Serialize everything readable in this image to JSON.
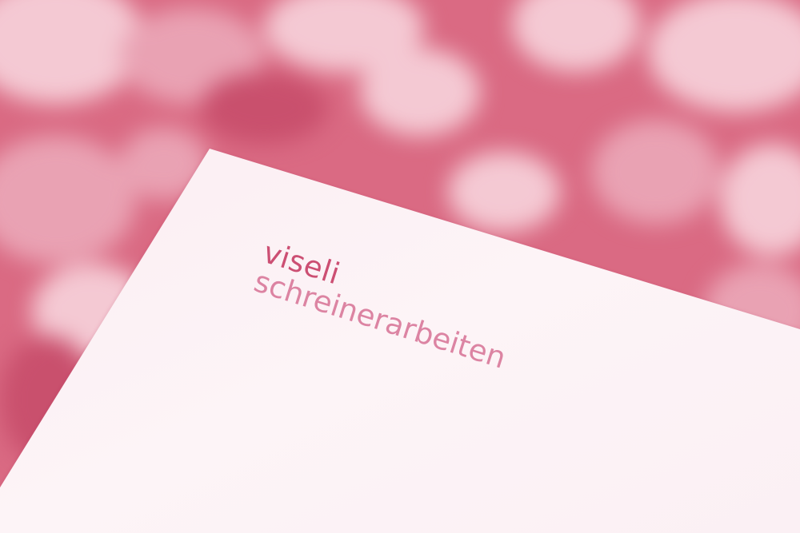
{
  "logo": {
    "brand": "viseli",
    "tagline": "schreinerarbeiten"
  },
  "colors": {
    "background": "#da6a83",
    "paper": "#fdf3f6",
    "brand_text": "#cc4f73",
    "tagline_text": "#d9789a"
  }
}
